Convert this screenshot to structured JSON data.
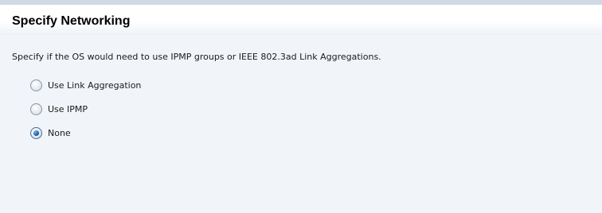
{
  "page": {
    "title": "Specify Networking",
    "description": "Specify if the OS would need to use IPMP groups or IEEE 802.3ad Link Aggregations."
  },
  "options": [
    {
      "label": "Use Link Aggregation",
      "selected": false
    },
    {
      "label": "Use IPMP",
      "selected": false
    },
    {
      "label": "None",
      "selected": true
    }
  ],
  "colors": {
    "background": "#f1f5fa",
    "selected_radio": "#1c5ea5"
  }
}
